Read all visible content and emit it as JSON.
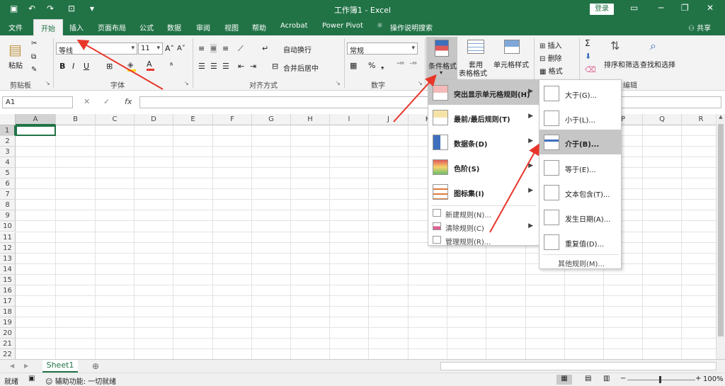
{
  "titlebar": {
    "title": "工作簿1 - Excel",
    "login": "登录"
  },
  "tabs": [
    "文件",
    "开始",
    "插入",
    "页面布局",
    "公式",
    "数据",
    "审阅",
    "视图",
    "帮助",
    "Acrobat",
    "Power Pivot",
    "操作说明搜索"
  ],
  "share": "共享",
  "ribbon": {
    "paste": "粘贴",
    "clipboard": "剪贴板",
    "font_name": "等线",
    "font_size": "11",
    "font_group": "字体",
    "wrap_text": "自动换行",
    "merge_center": "合并后居中",
    "align_group": "对齐方式",
    "number_format": "常规",
    "number_group": "数字",
    "cond_format": "条件格式",
    "table_format_1": "套用",
    "table_format_2": "表格格式",
    "cell_style": "单元格样式",
    "insert": "插入",
    "delete": "删除",
    "format": "格式",
    "sort_filter": "排序和筛选",
    "find_select": "查找和选择",
    "edit_group": "编辑"
  },
  "namebox": "A1",
  "columns": [
    "A",
    "B",
    "C",
    "D",
    "E",
    "F",
    "G",
    "H",
    "I",
    "J",
    "K",
    "L",
    "M",
    "N",
    "O",
    "P",
    "Q",
    "R"
  ],
  "rows": [
    "1",
    "2",
    "3",
    "4",
    "5",
    "6",
    "7",
    "8",
    "9",
    "10",
    "11",
    "12",
    "13",
    "14",
    "15",
    "16",
    "17",
    "18",
    "19",
    "20",
    "21",
    "22"
  ],
  "sheet_tab": "Sheet1",
  "status": {
    "ready": "就绪",
    "accessibility": "辅助功能: 一切就绪",
    "zoom": "100%"
  },
  "menu_main": {
    "items": [
      "突出显示单元格规则(H)",
      "最前/最后规则(T)",
      "数据条(D)",
      "色阶(S)",
      "图标集(I)"
    ],
    "small": [
      "新建规则(N)...",
      "清除规则(C)",
      "管理规则(R)..."
    ]
  },
  "menu_sub": {
    "items": [
      "大于(G)...",
      "小于(L)...",
      "介于(B)...",
      "等于(E)...",
      "文本包含(T)...",
      "发生日期(A)...",
      "重复值(D)..."
    ],
    "other": "其他规则(M)..."
  },
  "colors": {
    "brand": "#217346",
    "arrow": "#e8352a"
  }
}
